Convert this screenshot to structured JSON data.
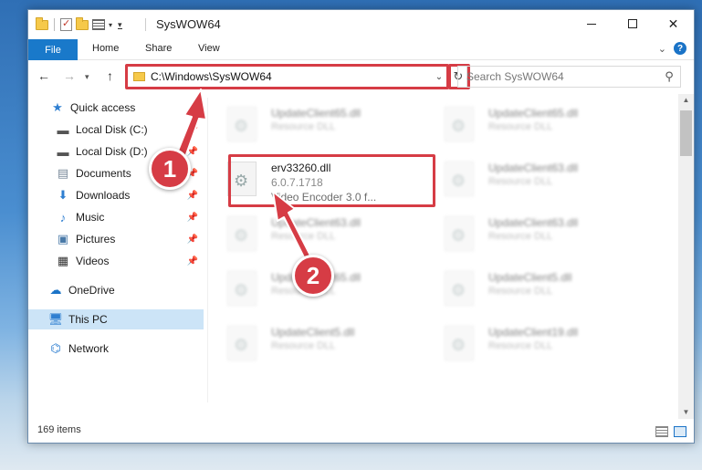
{
  "window": {
    "title": "SysWOW64",
    "controls": {
      "minimize": "minimize",
      "maximize": "maximize",
      "close": "✕"
    }
  },
  "ribbon": {
    "tabs": [
      {
        "label": "File",
        "active": true
      },
      {
        "label": "Home"
      },
      {
        "label": "Share"
      },
      {
        "label": "View"
      }
    ],
    "help": "?"
  },
  "nav": {
    "address": "C:\\Windows\\SysWOW64",
    "search_placeholder": "Search SysWOW64"
  },
  "sidebar": {
    "items": [
      {
        "label": "Quick access",
        "icon": "star-icon"
      },
      {
        "label": "Local Disk (C:)",
        "icon": "drive-icon",
        "pinned": true
      },
      {
        "label": "Local Disk (D:)",
        "icon": "drive-icon",
        "pinned": true
      },
      {
        "label": "Documents",
        "icon": "documents-icon",
        "pinned": true
      },
      {
        "label": "Downloads",
        "icon": "downloads-icon",
        "pinned": true
      },
      {
        "label": "Music",
        "icon": "music-icon",
        "pinned": true
      },
      {
        "label": "Pictures",
        "icon": "pictures-icon",
        "pinned": true
      },
      {
        "label": "Videos",
        "icon": "videos-icon",
        "pinned": true
      },
      {
        "label": "OneDrive",
        "icon": "cloud-icon"
      },
      {
        "label": "This PC",
        "icon": "computer-icon",
        "selected": true
      },
      {
        "label": "Network",
        "icon": "network-icon"
      }
    ]
  },
  "files": {
    "highlighted": {
      "name": "erv33260.dll",
      "version": "6.0.7.1718",
      "description": "Video Encoder 3.0 f..."
    },
    "blurred": [
      {
        "name": "UpdateClient65.dll",
        "desc": "Resource DLL"
      },
      {
        "name": "UpdateClient65.dll",
        "desc": "Resource DLL"
      },
      {
        "name": "UpdateClient63.dll",
        "desc": "Resource DLL"
      },
      {
        "name": "UpdateClient63.dll",
        "desc": "Resource DLL"
      },
      {
        "name": "UpdateClient63.dll",
        "desc": "Resource DLL"
      },
      {
        "name": "UpdateClient65.dll",
        "desc": "Resource DLL"
      },
      {
        "name": "UpdateClient5.dll",
        "desc": "Resource DLL"
      },
      {
        "name": "UpdateClient5.dll",
        "desc": "Resource DLL"
      },
      {
        "name": "UpdateClient19.dll",
        "desc": "Resource DLL"
      }
    ]
  },
  "status": {
    "item_count": "169 items"
  },
  "callouts": {
    "step1": "1",
    "step2": "2"
  },
  "colors": {
    "accent": "#1979ca",
    "highlight": "#d63c45",
    "selected": "#cce4f7"
  }
}
